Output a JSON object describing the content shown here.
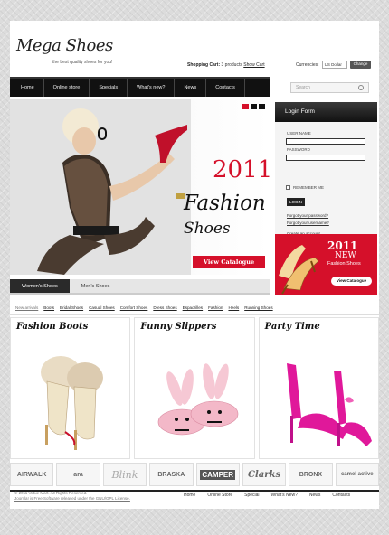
{
  "logo": {
    "title": "Mega Shoes",
    "tagline": "the best quality shoes for you!"
  },
  "header": {
    "cart_label": "Shopping Cart:",
    "cart_count": "3 products",
    "cart_link": "Show Cart",
    "currency_label": "Currencies:",
    "currency_value": "US Dollar",
    "currency_button": "Change"
  },
  "nav": {
    "items": [
      "Home",
      "Online store",
      "Specials",
      "What's new?",
      "News",
      "Contacts"
    ]
  },
  "search": {
    "placeholder": "Search"
  },
  "hero": {
    "year": "2011",
    "line1": "Fashion",
    "line2": "Shoes",
    "button": "View Catalogue"
  },
  "tabs": [
    "Women's Shoes",
    "Men's Shoes"
  ],
  "login": {
    "title": "Login Form",
    "user_label": "USER NAME",
    "pass_label": "PASSWORD",
    "remember": "REMEMBER ME",
    "button": "LOGIN",
    "forgot_pass": "Forgot your password?",
    "forgot_user": "Forgot your username?",
    "create": "Create an account"
  },
  "promo": {
    "year": "2011",
    "title": "NEW",
    "subtitle": "Fashion Shoes",
    "button": "View Catalogue"
  },
  "categories": [
    "New arrivals",
    "Boots",
    "Bridal Shoes",
    "Casual Shoes",
    "Comfort Shoes",
    "Dress Shoes",
    "Espadrilles",
    "Fashion",
    "Heels",
    "Running Shoes"
  ],
  "products": [
    {
      "title": "Fashion Boots"
    },
    {
      "title": "Funny Slippers"
    },
    {
      "title": "Party Time"
    }
  ],
  "brands": [
    "AIRWALK",
    "ara",
    "Blink",
    "BRASKA",
    "CAMPER",
    "Clarks",
    "BRONX",
    "camel active"
  ],
  "footer": {
    "copyright": "© 2011 Virtue Mart. All Rights Reserved.",
    "license": "Joomla! is Free Software released under the GNU/GPL License.",
    "nav": [
      "Home",
      "Online Store",
      "Special",
      "What's New?",
      "News",
      "Contacts"
    ]
  },
  "colors": {
    "accent": "#d5102a",
    "nav_bg": "#111111"
  }
}
